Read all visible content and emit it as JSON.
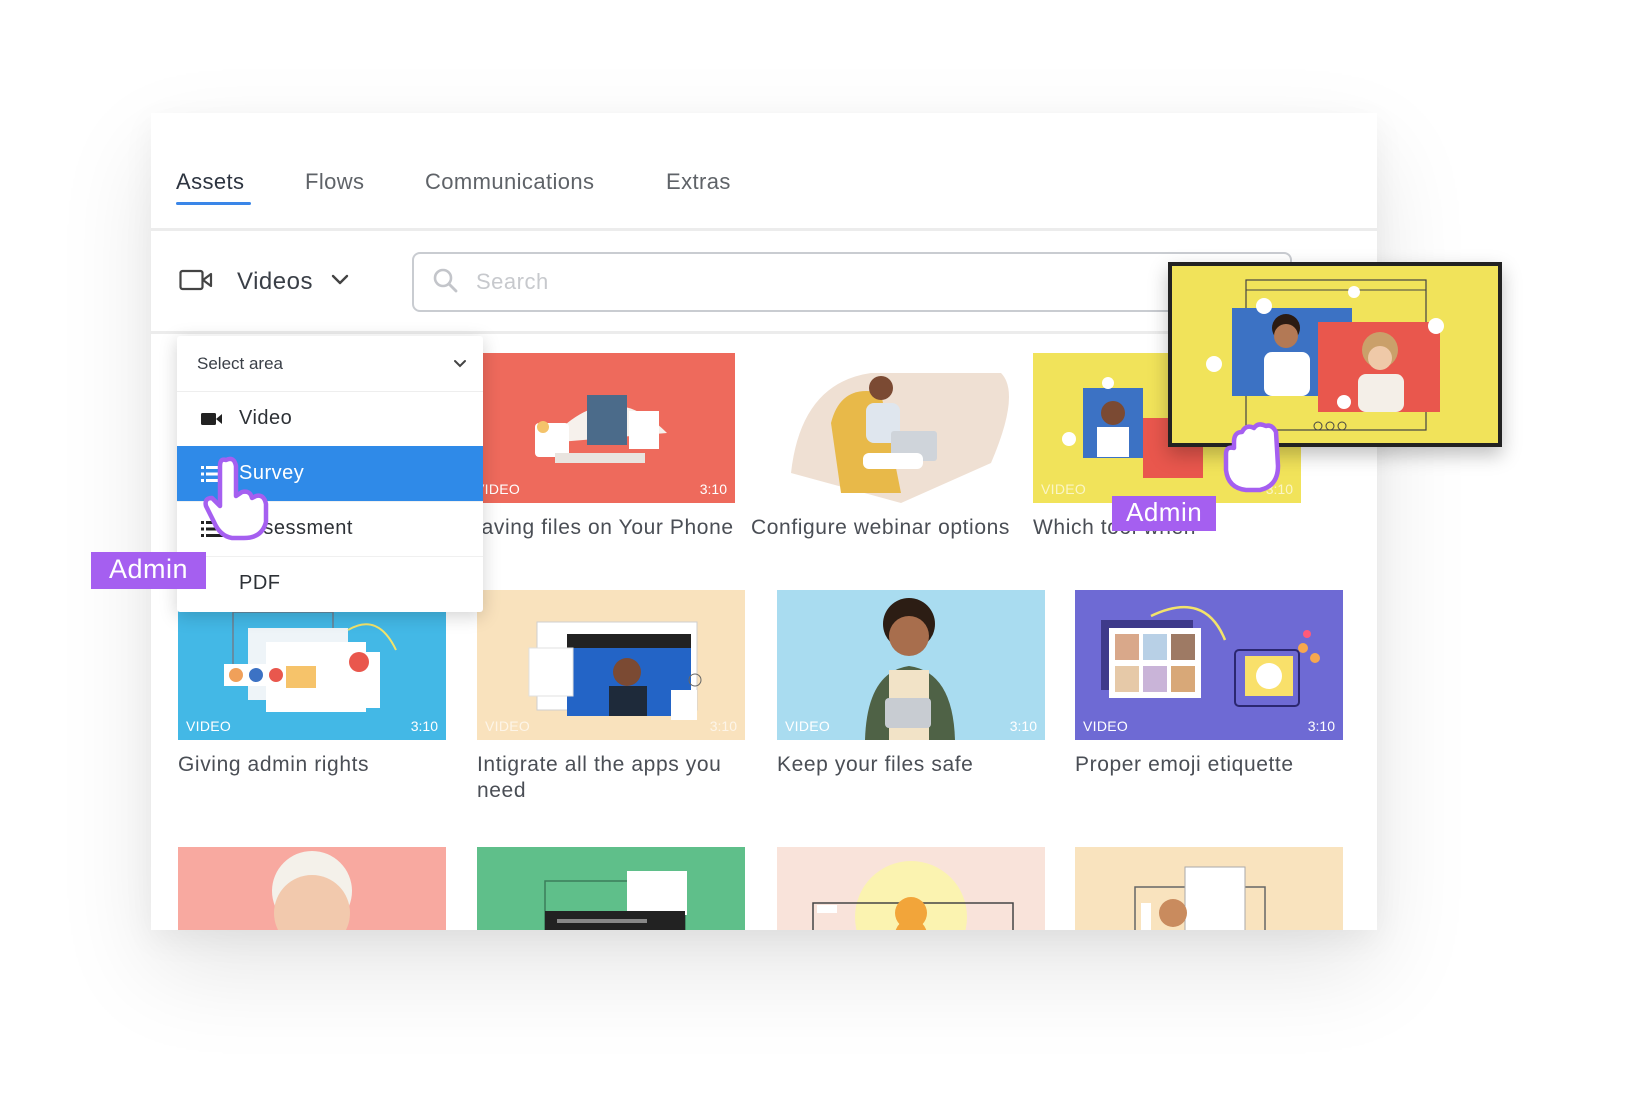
{
  "tabs": [
    {
      "label": "Assets",
      "active": true
    },
    {
      "label": "Flows",
      "active": false
    },
    {
      "label": "Communications",
      "active": false
    },
    {
      "label": "Extras",
      "active": false
    }
  ],
  "type_selector": {
    "label": "Videos",
    "icon": "video-camera-icon"
  },
  "search": {
    "placeholder": "Search",
    "value": ""
  },
  "dropdown": {
    "header": "Select area",
    "items": [
      {
        "label": "Video",
        "icon": "video-camera-icon",
        "selected": false
      },
      {
        "label": "Survey",
        "icon": "list-icon",
        "selected": true
      },
      {
        "label": "Assessment",
        "icon": "list-icon",
        "selected": false
      },
      {
        "label": "PDF",
        "icon": "document-icon",
        "selected": false
      }
    ]
  },
  "cards": [
    {
      "title": "Saving files on Your Phone",
      "badge": "VIDEO",
      "duration": "3:10",
      "bg": "#ee6a5c"
    },
    {
      "title": "Configure webinar options",
      "badge": "",
      "duration": "",
      "bg": "#f6ede6"
    },
    {
      "title": "Which tool when",
      "badge": "VIDEO",
      "duration": "3:10",
      "bg": "#f1e35a"
    },
    {
      "title": "Giving admin rights",
      "badge": "VIDEO",
      "duration": "3:10",
      "bg": "#43b8e6"
    },
    {
      "title": "Intigrate all the apps you need",
      "badge": "VIDEO",
      "duration": "3:10",
      "bg": "#f9e2bd"
    },
    {
      "title": "Keep your files safe",
      "badge": "VIDEO",
      "duration": "3:10",
      "bg": "#a9dcf0"
    },
    {
      "title": "Proper emoji etiquette",
      "badge": "VIDEO",
      "duration": "3:10",
      "bg": "#6e6ad4"
    },
    {
      "title": "",
      "badge": "",
      "duration": "",
      "bg": "#f8a9a0"
    },
    {
      "title": "",
      "badge": "",
      "duration": "",
      "bg": "#5fbf8a"
    },
    {
      "title": "",
      "badge": "",
      "duration": "",
      "bg": "#f9e3da"
    },
    {
      "title": "",
      "badge": "",
      "duration": "",
      "bg": "#f9e3be"
    }
  ],
  "admin_tags": [
    "Admin",
    "Admin"
  ],
  "colors": {
    "accent": "#3a86e8",
    "selected": "#2f8ae8",
    "admin": "#a55ff0"
  }
}
